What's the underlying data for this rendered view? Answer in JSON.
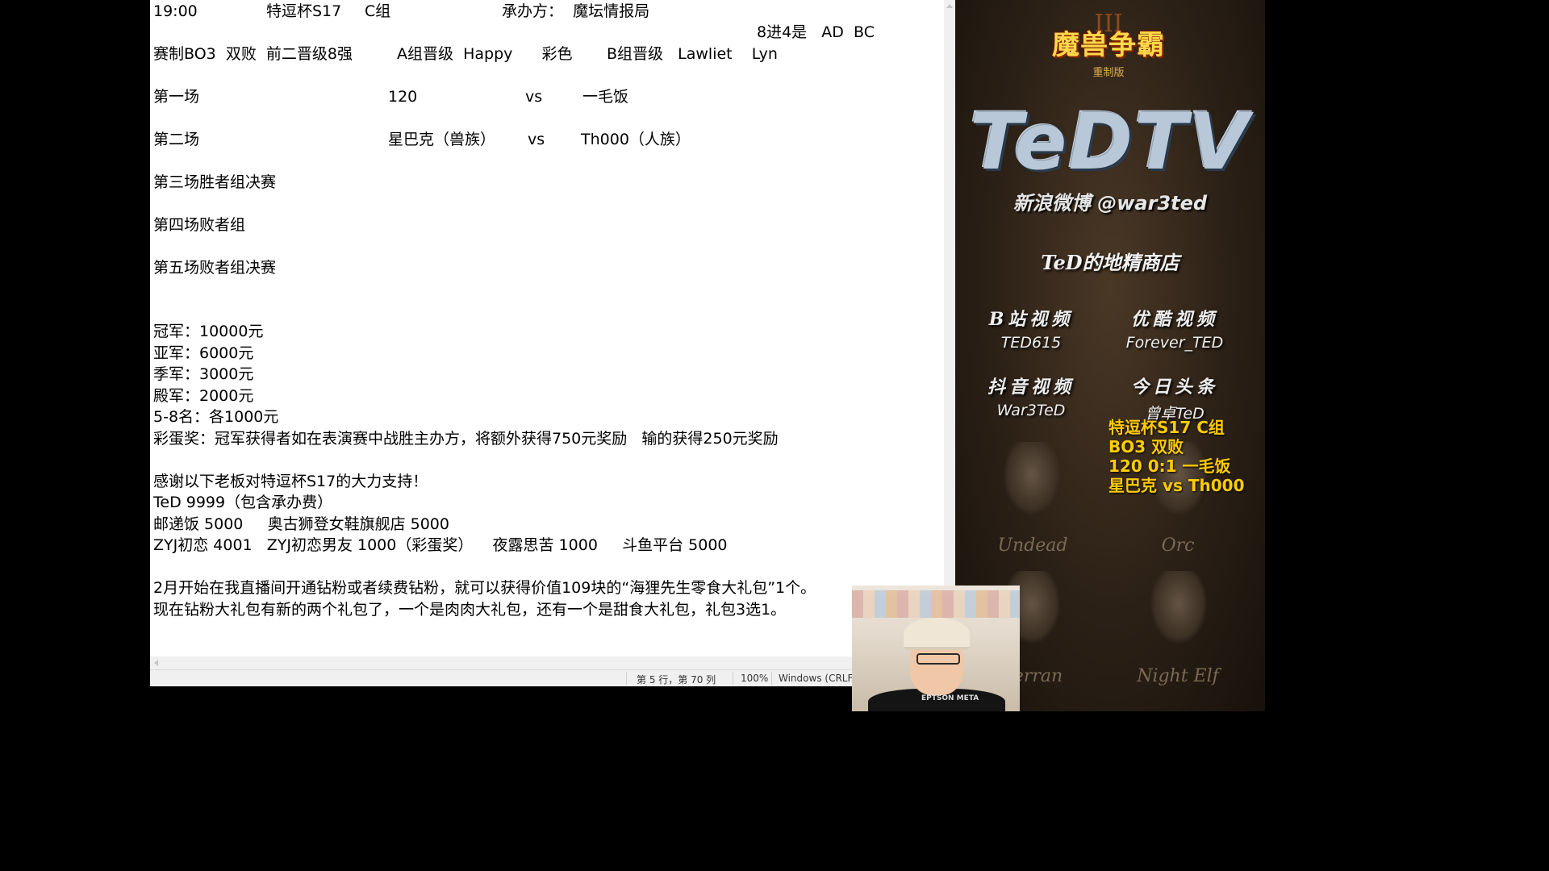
{
  "notepad": {
    "lines": {
      "l1_time": "19:00",
      "l1_cup": "特逗杯S17",
      "l1_group": "C组",
      "l1_host": "承办方：  魔坛情报局",
      "l2_semis": "8进4是   AD  BC",
      "l3_format": "赛制BO3  双败  前二晋级8强",
      "l3_a": "A组晋级  Happy      彩色",
      "l3_b": "B组晋级   Lawliet    Lyn",
      "m1_label": "第一场",
      "m1_p1": "120",
      "m1_vs": "vs",
      "m1_p2": "一毛饭",
      "m2_label": "第二场",
      "m2_p1": "星巴克（兽族）",
      "m2_vs": "vs",
      "m2_p2": "Th000（人族）",
      "m3": "第三场胜者组决赛",
      "m4": "第四场败者组",
      "m5": "第五场败者组决赛",
      "p1": "冠军：10000元",
      "p2": "亚军：6000元",
      "p3": "季军：3000元",
      "p4": "殿军：2000元",
      "p5": "5-8名：各1000元",
      "p6": "彩蛋奖：冠军获得者如在表演赛中战胜主办方，将额外获得750元奖励   输的获得250元奖励",
      "t1": "感谢以下老板对特逗杯S17的大力支持！",
      "t2": "TeD 9999（包含承办费）",
      "t3": "邮递饭 5000     奥古狮登女鞋旗舰店 5000",
      "t4": "ZYJ初恋 4001   ZYJ初恋男友 1000（彩蛋奖）    夜露思苦 1000     斗鱼平台 5000",
      "f1": "2月开始在我直播间开通钻粉或者续费钻粉，就可以获得价值109块的“海狸先生零食大礼包”1个。",
      "f2": "现在钻粉大礼包有新的两个礼包了，一个是肉肉大礼包，还有一个是甜食大礼包，礼包3选1。"
    },
    "status": {
      "position": "第 5 行，第 70 列",
      "zoom": "100%",
      "line_ending": "Windows (CRLF)"
    }
  },
  "panel": {
    "w3_title": "魔兽争霸",
    "w3_sub": "重制版",
    "w3_roman": "III",
    "tedtv": "TeDTV",
    "weibo": "新浪微博 @war3ted",
    "shop": "TeD的地精商店",
    "videos": [
      {
        "head": "B站视频",
        "sub": "TED615"
      },
      {
        "head": "优酷视频",
        "sub": "Forever_TED"
      },
      {
        "head": "抖音视频",
        "sub": "War3TeD"
      },
      {
        "head": "今日头条",
        "sub": "曾卓TeD"
      }
    ],
    "races": [
      "Undead",
      "Orc",
      "Terran",
      "Night Elf"
    ],
    "overlay": [
      "特逗杯S17 C组",
      "BO3 双败",
      "120 0:1 一毛饭",
      "星巴克 vs Th000"
    ]
  },
  "webcam": {
    "shirt_text": "EPTSON META"
  }
}
